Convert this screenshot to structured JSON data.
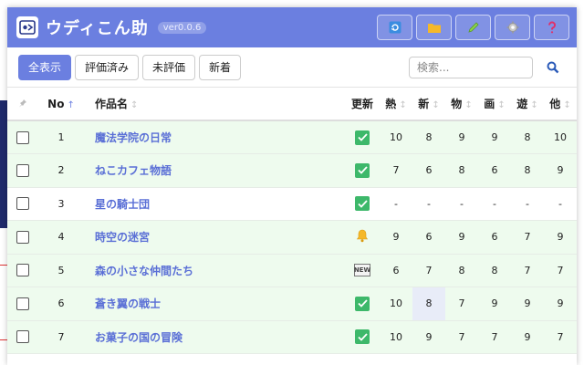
{
  "header": {
    "title": "ウディこん助",
    "version": "ver0.0.6",
    "buttons": [
      {
        "name": "refresh-button",
        "icon": "refresh-icon"
      },
      {
        "name": "folder-button",
        "icon": "folder-icon"
      },
      {
        "name": "edit-button",
        "icon": "pencil-icon"
      },
      {
        "name": "settings-button",
        "icon": "gear-icon"
      },
      {
        "name": "help-button",
        "icon": "question-icon"
      }
    ]
  },
  "toolbar": {
    "filters": [
      "全表示",
      "評価済み",
      "未評価",
      "新着"
    ],
    "active_filter": "全表示",
    "search_placeholder": "検索..."
  },
  "table": {
    "columns": {
      "no": "No",
      "title": "作品名",
      "update": "更新",
      "netsu": "熱",
      "shin": "新",
      "mono": "物",
      "ga": "画",
      "asobi": "遊",
      "ta": "他"
    },
    "sorted_column": "no",
    "rows": [
      {
        "no": "1",
        "title": "魔法学院の日常",
        "status": "check",
        "scores": [
          "10",
          "8",
          "9",
          "9",
          "8",
          "10"
        ],
        "bg": "green"
      },
      {
        "no": "2",
        "title": "ねこカフェ物語",
        "status": "check",
        "scores": [
          "7",
          "6",
          "8",
          "6",
          "8",
          "9"
        ],
        "bg": "green"
      },
      {
        "no": "3",
        "title": "星の騎士団",
        "status": "check",
        "scores": [
          "-",
          "-",
          "-",
          "-",
          "-",
          "-"
        ],
        "bg": "white"
      },
      {
        "no": "4",
        "title": "時空の迷宮",
        "status": "bell",
        "scores": [
          "9",
          "6",
          "9",
          "6",
          "7",
          "9"
        ],
        "bg": "green"
      },
      {
        "no": "5",
        "title": "森の小さな仲間たち",
        "status": "new",
        "scores": [
          "6",
          "7",
          "8",
          "8",
          "7",
          "7"
        ],
        "bg": "green"
      },
      {
        "no": "6",
        "title": "蒼き翼の戦士",
        "status": "check",
        "scores": [
          "10",
          "8",
          "7",
          "9",
          "9",
          "9"
        ],
        "bg": "green"
      },
      {
        "no": "7",
        "title": "お菓子の国の冒険",
        "status": "check",
        "scores": [
          "10",
          "9",
          "7",
          "7",
          "9",
          "7"
        ],
        "bg": "green"
      }
    ],
    "new_badge": "NEW"
  },
  "colors": {
    "accent": "#6b7fe0",
    "row_green": "#eefbee",
    "check_green": "#3db86a",
    "link": "#5a6fd6"
  }
}
